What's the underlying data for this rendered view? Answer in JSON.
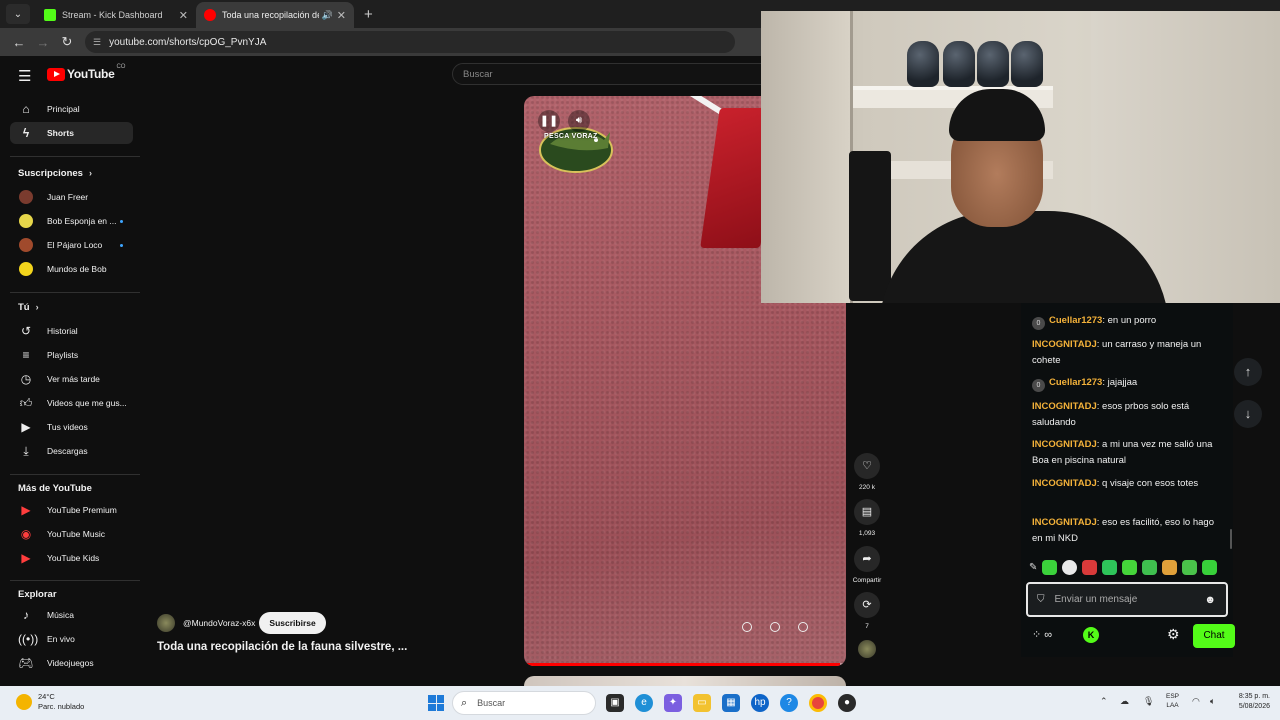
{
  "browser": {
    "tabs": [
      {
        "title": "Stream - Kick Dashboard",
        "active": false,
        "favicon_color": "#53fc18"
      },
      {
        "title": "Toda una recopilación de la",
        "active": true,
        "favicon_color": "#ff0000"
      }
    ],
    "url": "youtube.com/shorts/cpOG_PvnYJA"
  },
  "youtube": {
    "logo_text": "YouTube",
    "country": "CO",
    "search_placeholder": "Buscar",
    "nav": [
      {
        "label": "Principal",
        "icon": "home-icon"
      },
      {
        "label": "Shorts",
        "icon": "shorts-icon",
        "active": true
      }
    ],
    "subscriptions_title": "Suscripciones",
    "subscriptions": [
      {
        "label": "Juan Freer",
        "color": "#7a3b2e",
        "live_dot": false
      },
      {
        "label": "Bob Esponja en ...",
        "color": "#e6d64a",
        "live_dot": true
      },
      {
        "label": "El Pájaro Loco",
        "color": "#a04a2c",
        "live_dot": true
      },
      {
        "label": "Mundos de Bob",
        "color": "#f2d41c",
        "live_dot": false
      }
    ],
    "you_title": "Tú",
    "you_items": [
      {
        "label": "Historial",
        "icon": "history-icon"
      },
      {
        "label": "Playlists",
        "icon": "playlist-icon"
      },
      {
        "label": "Ver más tarde",
        "icon": "clock-icon"
      },
      {
        "label": "Videos que me gus...",
        "icon": "thumbs-up-icon"
      },
      {
        "label": "Tus videos",
        "icon": "video-icon"
      },
      {
        "label": "Descargas",
        "icon": "download-icon"
      }
    ],
    "more_title": "Más de YouTube",
    "more_items": [
      {
        "label": "YouTube Premium"
      },
      {
        "label": "YouTube Music"
      },
      {
        "label": "YouTube Kids"
      }
    ],
    "explore_title": "Explorar",
    "explore_items": [
      {
        "label": "Música",
        "icon": "music-icon"
      },
      {
        "label": "En vivo",
        "icon": "live-icon"
      },
      {
        "label": "Videojuegos",
        "icon": "gamepad-icon"
      }
    ]
  },
  "short": {
    "watermark": "PESCA VORAZ",
    "progress": 0.98,
    "likes": "220 k",
    "comments": "1,093",
    "share_label": "Compartir",
    "remix_count": "7",
    "channel": "@MundoVoraz-x6x",
    "subscribe_label": "Suscribirse",
    "title": "Toda una recopilación de la fauna silvestre, ..."
  },
  "chat": {
    "messages": [
      {
        "user": "Cuellar1273",
        "text": "en un porro",
        "badge": "0",
        "user_color": "#f4b23a"
      },
      {
        "user": "INCOGNITADJ",
        "text": "un carraso y maneja un cohete",
        "badge": "",
        "user_color": "#f4b23a"
      },
      {
        "user": "Cuellar1273",
        "text": "jajajjaa",
        "badge": "0",
        "user_color": "#f4b23a"
      },
      {
        "user": "INCOGNITADJ",
        "text": "esos prbos solo está saludando",
        "badge": "",
        "user_color": "#f4b23a"
      },
      {
        "user": "INCOGNITADJ",
        "text": "a mi una vez me salió una Boa en piscina natural",
        "badge": "",
        "user_color": "#f4b23a"
      },
      {
        "user": "INCOGNITADJ",
        "text": "q visaje con esos totes",
        "badge": "",
        "user_color": "#f4b23a"
      },
      {
        "user": "INCOGNITADJ",
        "text": "eso es facilitó, eso lo hago en mi NKD",
        "badge": "",
        "user_color": "#f4b23a"
      }
    ],
    "input_placeholder": "Enviar un mensaje",
    "points_label": "∞",
    "send_label": "Chat",
    "accent": "#53fc18"
  },
  "taskbar": {
    "temperature": "24°C",
    "weather": "Parc. nublado",
    "search_placeholder": "Buscar",
    "lang_top": "ESP",
    "lang_bottom": "LAA",
    "time": "8:35 p. m.",
    "date": "5/08/2026"
  }
}
